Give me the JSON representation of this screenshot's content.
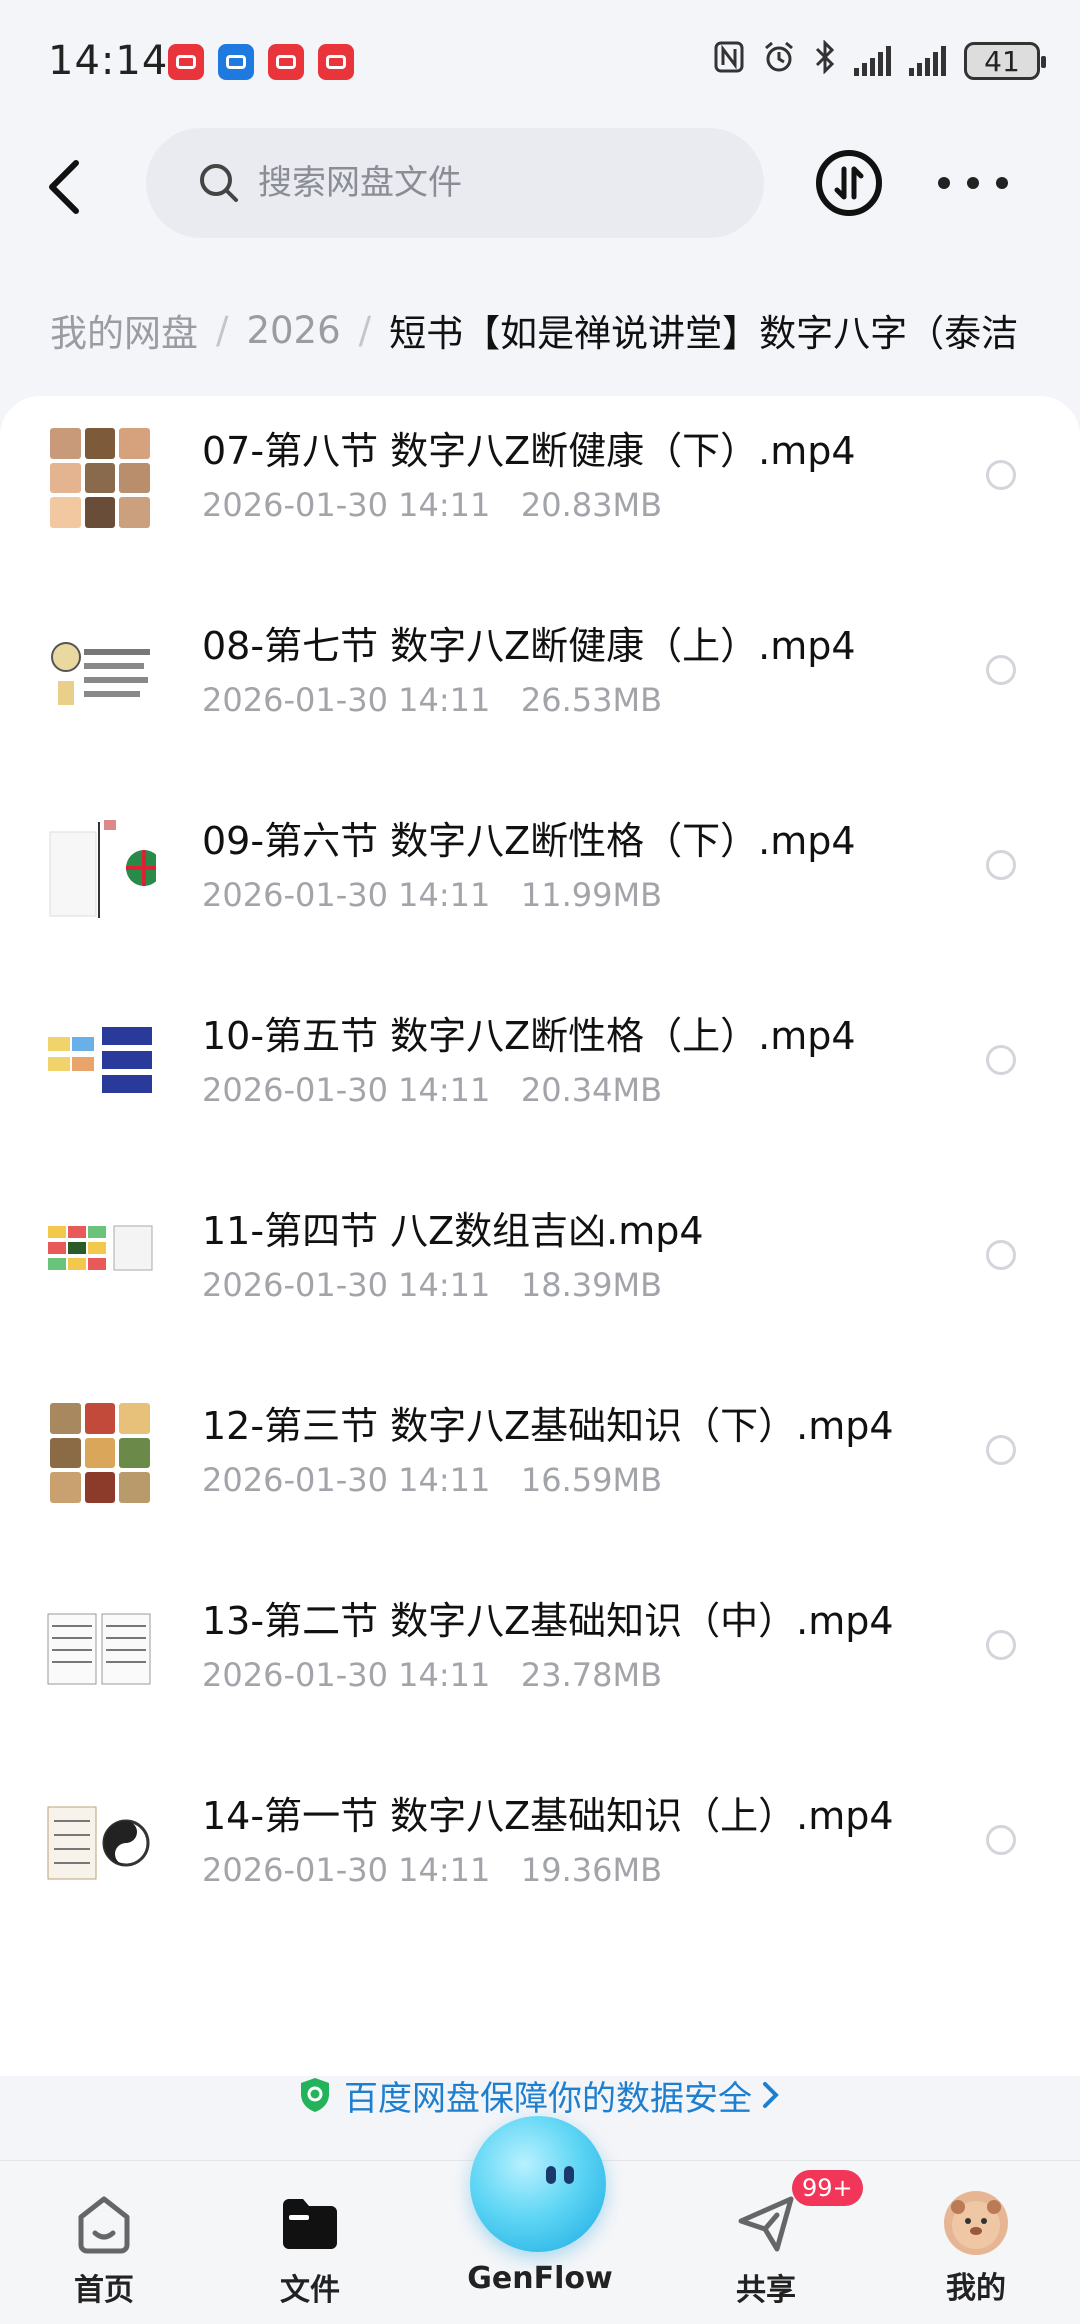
{
  "status_bar": {
    "time": "14:14",
    "battery": "41"
  },
  "header": {
    "search_placeholder": "搜索网盘文件"
  },
  "breadcrumb": {
    "items": [
      "我的网盘",
      "2026"
    ],
    "current": "短书【如是禅说讲堂】数字八字（泰洁"
  },
  "files": [
    {
      "name": "07-第八节 数字八Z断健康（下）.mp4",
      "date": "2026-01-30  14:11",
      "size": "20.83MB"
    },
    {
      "name": "08-第七节 数字八Z断健康（上）.mp4",
      "date": "2026-01-30  14:11",
      "size": "26.53MB"
    },
    {
      "name": "09-第六节 数字八Z断性格（下）.mp4",
      "date": "2026-01-30  14:11",
      "size": "11.99MB"
    },
    {
      "name": "10-第五节 数字八Z断性格（上）.mp4",
      "date": "2026-01-30  14:11",
      "size": "20.34MB"
    },
    {
      "name": "11-第四节 八Z数组吉凶.mp4",
      "date": "2026-01-30  14:11",
      "size": "18.39MB"
    },
    {
      "name": "12-第三节 数字八Z基础知识（下）.mp4",
      "date": "2026-01-30  14:11",
      "size": "16.59MB"
    },
    {
      "name": "13-第二节 数字八Z基础知识（中）.mp4",
      "date": "2026-01-30  14:11",
      "size": "23.78MB"
    },
    {
      "name": "14-第一节 数字八Z基础知识（上）.mp4",
      "date": "2026-01-30  14:11",
      "size": "19.36MB"
    }
  ],
  "banner": {
    "text": "百度网盘保障你的数据安全"
  },
  "bottom_nav": {
    "home": "首页",
    "files": "文件",
    "genflow": "GenFlow",
    "share": "共享",
    "share_badge": "99+",
    "me": "我的"
  }
}
